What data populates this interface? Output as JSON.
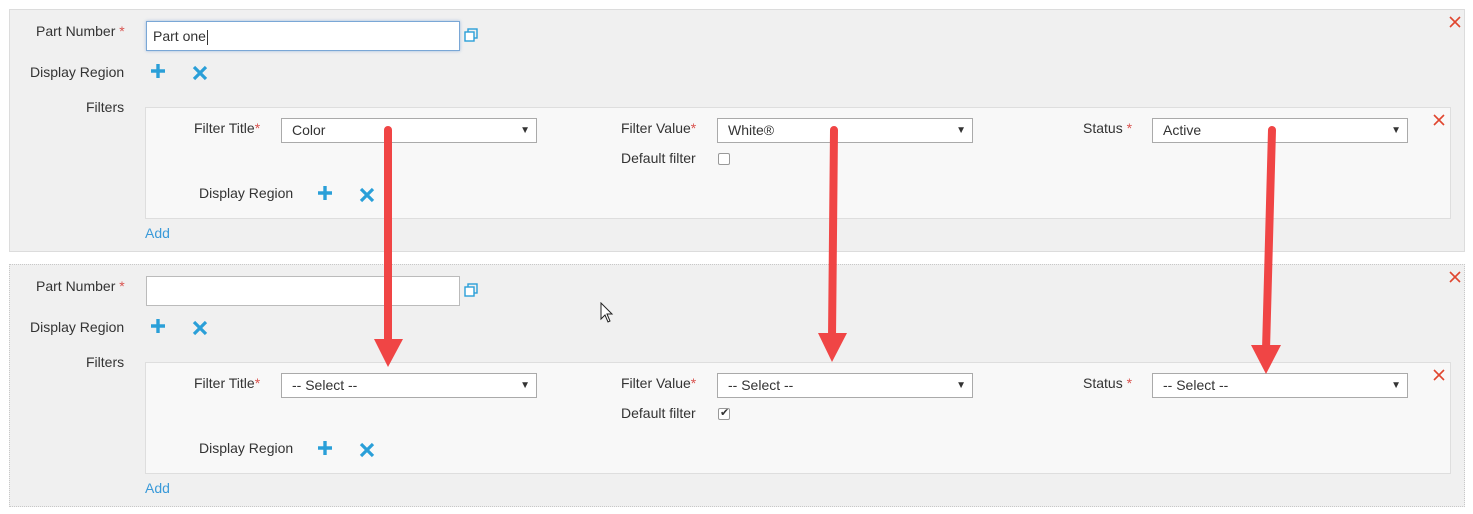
{
  "labels": {
    "part_number": "Part Number",
    "required": "*",
    "display_region": "Display Region",
    "filters": "Filters",
    "filter_title": "Filter Title",
    "filter_value": "Filter Value",
    "status": "Status",
    "default_filter": "Default filter",
    "add": "Add"
  },
  "parts": [
    {
      "part_number_value": "Part one",
      "filter_title_value": "Color",
      "filter_value_value": "White®",
      "status_value": "Active",
      "default_filter_checked": false
    },
    {
      "part_number_value": "",
      "filter_title_value": "-- Select --",
      "filter_value_value": "-- Select --",
      "status_value": "-- Select --",
      "default_filter_checked": true
    }
  ],
  "icons": {
    "copy": "copy-icon",
    "add": "plus-icon",
    "remove": "x-icon",
    "close": "close-icon",
    "dropdown": "caret-down-icon"
  },
  "colors": {
    "accent_blue": "#2a9fd8",
    "close_red": "#e0462f",
    "annotation_red": "#f04545",
    "link_blue": "#3a9ad9"
  }
}
